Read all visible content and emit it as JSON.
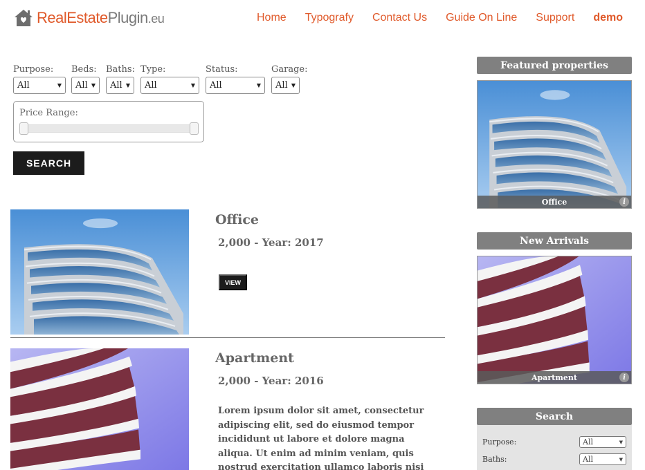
{
  "brand": {
    "name_part1": "RealEstate",
    "name_part2": "Plugin",
    "name_part3": ".eu",
    "accent_color": "#e05a2b"
  },
  "nav": {
    "items": [
      {
        "label": "Home"
      },
      {
        "label": "Typografy"
      },
      {
        "label": "Contact Us"
      },
      {
        "label": "Guide On Line"
      },
      {
        "label": "Support"
      },
      {
        "label": "demo"
      }
    ]
  },
  "filters": {
    "purpose": {
      "label": "Purpose:",
      "value": "All"
    },
    "beds": {
      "label": "Beds:",
      "value": "All"
    },
    "baths": {
      "label": "Baths:",
      "value": "All"
    },
    "type": {
      "label": "Type:",
      "value": "All"
    },
    "status": {
      "label": "Status:",
      "value": "All"
    },
    "garage": {
      "label": "Garage:",
      "value": "All"
    },
    "price_range_label": "Price Range:",
    "search_label": "SEARCH"
  },
  "listings": [
    {
      "title": "Office",
      "subtitle": "2,000 - Year: 2017",
      "view_label": "VIEW"
    },
    {
      "title": "Apartment",
      "subtitle": "2,000 - Year: 2016",
      "description": "Lorem ipsum dolor sit amet, consectetur adipiscing elit, sed do eiusmod tempor incididunt ut labore et dolore magna aliqua. Ut enim ad minim veniam, quis nostrud exercitation ullamco laboris nisi"
    }
  ],
  "sidebar": {
    "featured": {
      "heading": "Featured properties",
      "caption": "Office"
    },
    "new_arrivals": {
      "heading": "New Arrivals",
      "caption": "Apartment"
    },
    "search": {
      "heading": "Search",
      "purpose_label": "Purpose:",
      "purpose_value": "All",
      "baths_label": "Baths:",
      "baths_value": "All"
    },
    "info_glyph": "i"
  }
}
